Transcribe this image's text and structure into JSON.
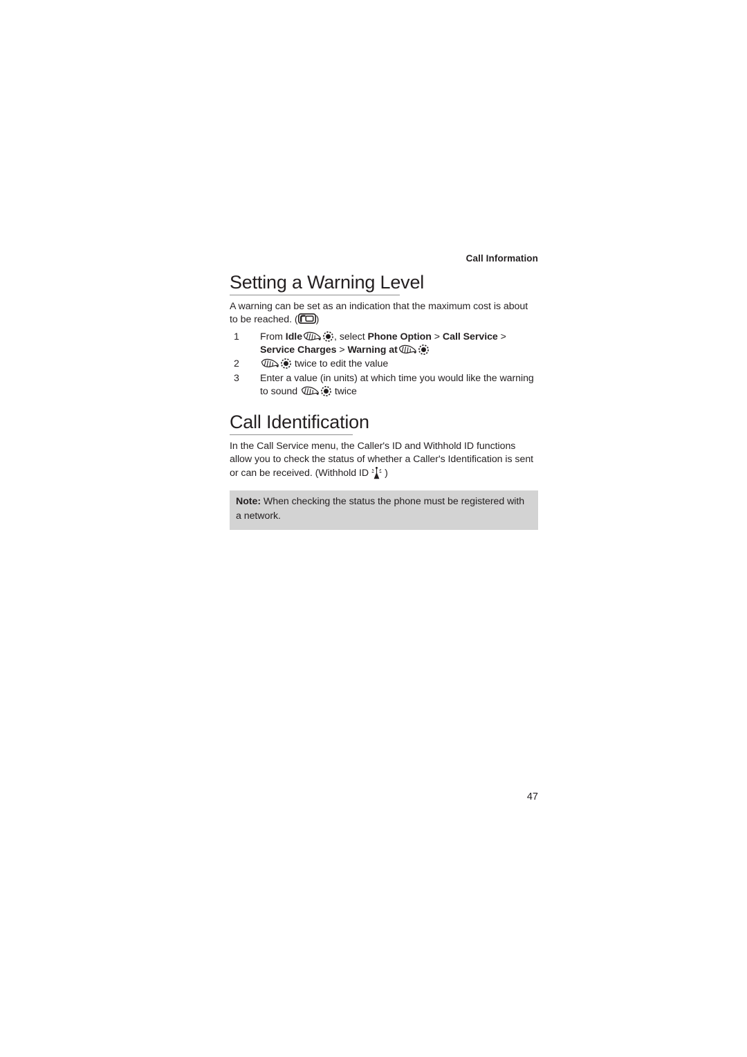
{
  "page": {
    "running_head": "Call Information",
    "page_number": "47",
    "background_color": "#ffffff",
    "text_color": "#231f20",
    "rule_color": "#8d8d8d",
    "note_background": "#d3d3d3"
  },
  "sections": [
    {
      "id": "setting-a-warning-level",
      "title": "Setting a Warning Level",
      "intro_part1": "A warning can be set as an indication that the maximum cost is about to be reached. (",
      "intro_icon": "softkey-icon",
      "intro_part2": ")",
      "steps": [
        {
          "number": "1",
          "segments": [
            {
              "type": "text",
              "value": "From "
            },
            {
              "type": "bold",
              "value": "Idle"
            },
            {
              "type": "space",
              "value": " "
            },
            {
              "type": "icon",
              "value": "scroll-key-icon"
            },
            {
              "type": "icon",
              "value": "select-key-icon"
            },
            {
              "type": "text",
              "value": ", select "
            },
            {
              "type": "bold",
              "value": "Phone Option"
            },
            {
              "type": "text",
              "value": " > "
            },
            {
              "type": "bold",
              "value": "Call Service"
            },
            {
              "type": "text",
              "value": " > "
            },
            {
              "type": "bold",
              "value": "Service Charges"
            },
            {
              "type": "text",
              "value": " > "
            },
            {
              "type": "bold",
              "value": "Warning at"
            },
            {
              "type": "icon",
              "value": "scroll-key-icon"
            },
            {
              "type": "icon",
              "value": "select-key-icon"
            }
          ],
          "plain_text": "From Idle , select Phone Option > Call Service > Service Charges > Warning at"
        },
        {
          "number": "2",
          "segments": [
            {
              "type": "icon",
              "value": "scroll-key-icon"
            },
            {
              "type": "icon",
              "value": "select-key-icon"
            },
            {
              "type": "text",
              "value": " twice to edit the value"
            }
          ],
          "plain_text": "twice to edit the value"
        },
        {
          "number": "3",
          "segments": [
            {
              "type": "text",
              "value": "Enter a value (in units) at which time you would like the warning to sound "
            },
            {
              "type": "icon",
              "value": "scroll-key-icon"
            },
            {
              "type": "icon",
              "value": "select-key-icon"
            },
            {
              "type": "text",
              "value": " twice"
            }
          ],
          "plain_text": "Enter a value (in units) at which time you would like the warning to sound twice"
        }
      ]
    },
    {
      "id": "call-identification",
      "title": "Call Identification",
      "intro_part1": "In the Call Service menu, the Caller's ID and Withhold ID functions allow you to check the status of whether a Caller's Identification is sent or can be received. (Withhold ID",
      "intro_icon": "antenna-icon",
      "intro_part2": ")",
      "note": {
        "label": "Note:",
        "text": " When checking the status the phone must be registered with a network."
      }
    }
  ],
  "step_labels": {
    "one": "1",
    "two": "2",
    "three": "3"
  },
  "step1": {
    "t1": "From ",
    "b1": "Idle",
    "t2": ", select ",
    "b2": "Phone Option",
    "t3": " > ",
    "b3": "Call Service",
    "t4": " > ",
    "b4": "Service Charges",
    "t5": " > ",
    "b5": "Warning at"
  },
  "step2": {
    "t1": " twice to edit the value"
  },
  "step3": {
    "t1": "Enter a value (in units) at which time you would like the warning to sound ",
    "t2": " twice"
  }
}
